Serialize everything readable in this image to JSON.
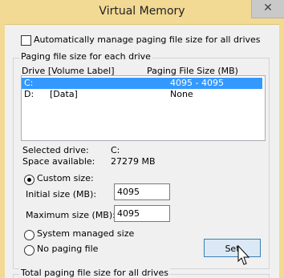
{
  "window": {
    "title": "Virtual Memory",
    "close_glyph": "✕"
  },
  "auto_manage": {
    "label": "Automatically manage paging file size for all drives",
    "checked": false
  },
  "paging_group": {
    "label": "Paging file size for each drive"
  },
  "table": {
    "headers": {
      "drive": "Drive  [Volume Label]",
      "size": "Paging File Size (MB)"
    },
    "rows": [
      {
        "drive": "C:",
        "label": "",
        "size": "4095 - 4095",
        "selected": true
      },
      {
        "drive": "D:",
        "label": "[Data]",
        "size": "None",
        "selected": false
      }
    ]
  },
  "selected_drive": {
    "label": "Selected drive:",
    "value": "C:"
  },
  "space_available": {
    "label": "Space available:",
    "value": "27279 MB"
  },
  "custom_size": {
    "label": "Custom size:",
    "selected": true
  },
  "initial_size": {
    "label": "Initial size (MB):",
    "value": "4095"
  },
  "maximum_size": {
    "label": "Maximum size (MB):",
    "value": "4095"
  },
  "system_managed": {
    "label": "System managed size"
  },
  "no_paging": {
    "label": "No paging file"
  },
  "set_button": {
    "label": "Set"
  },
  "total_group": {
    "label": "Total paging file size for all drives"
  },
  "colors": {
    "titlebar": "#f2d994",
    "selection": "#3399ff",
    "button_border": "#3c7fb1"
  }
}
